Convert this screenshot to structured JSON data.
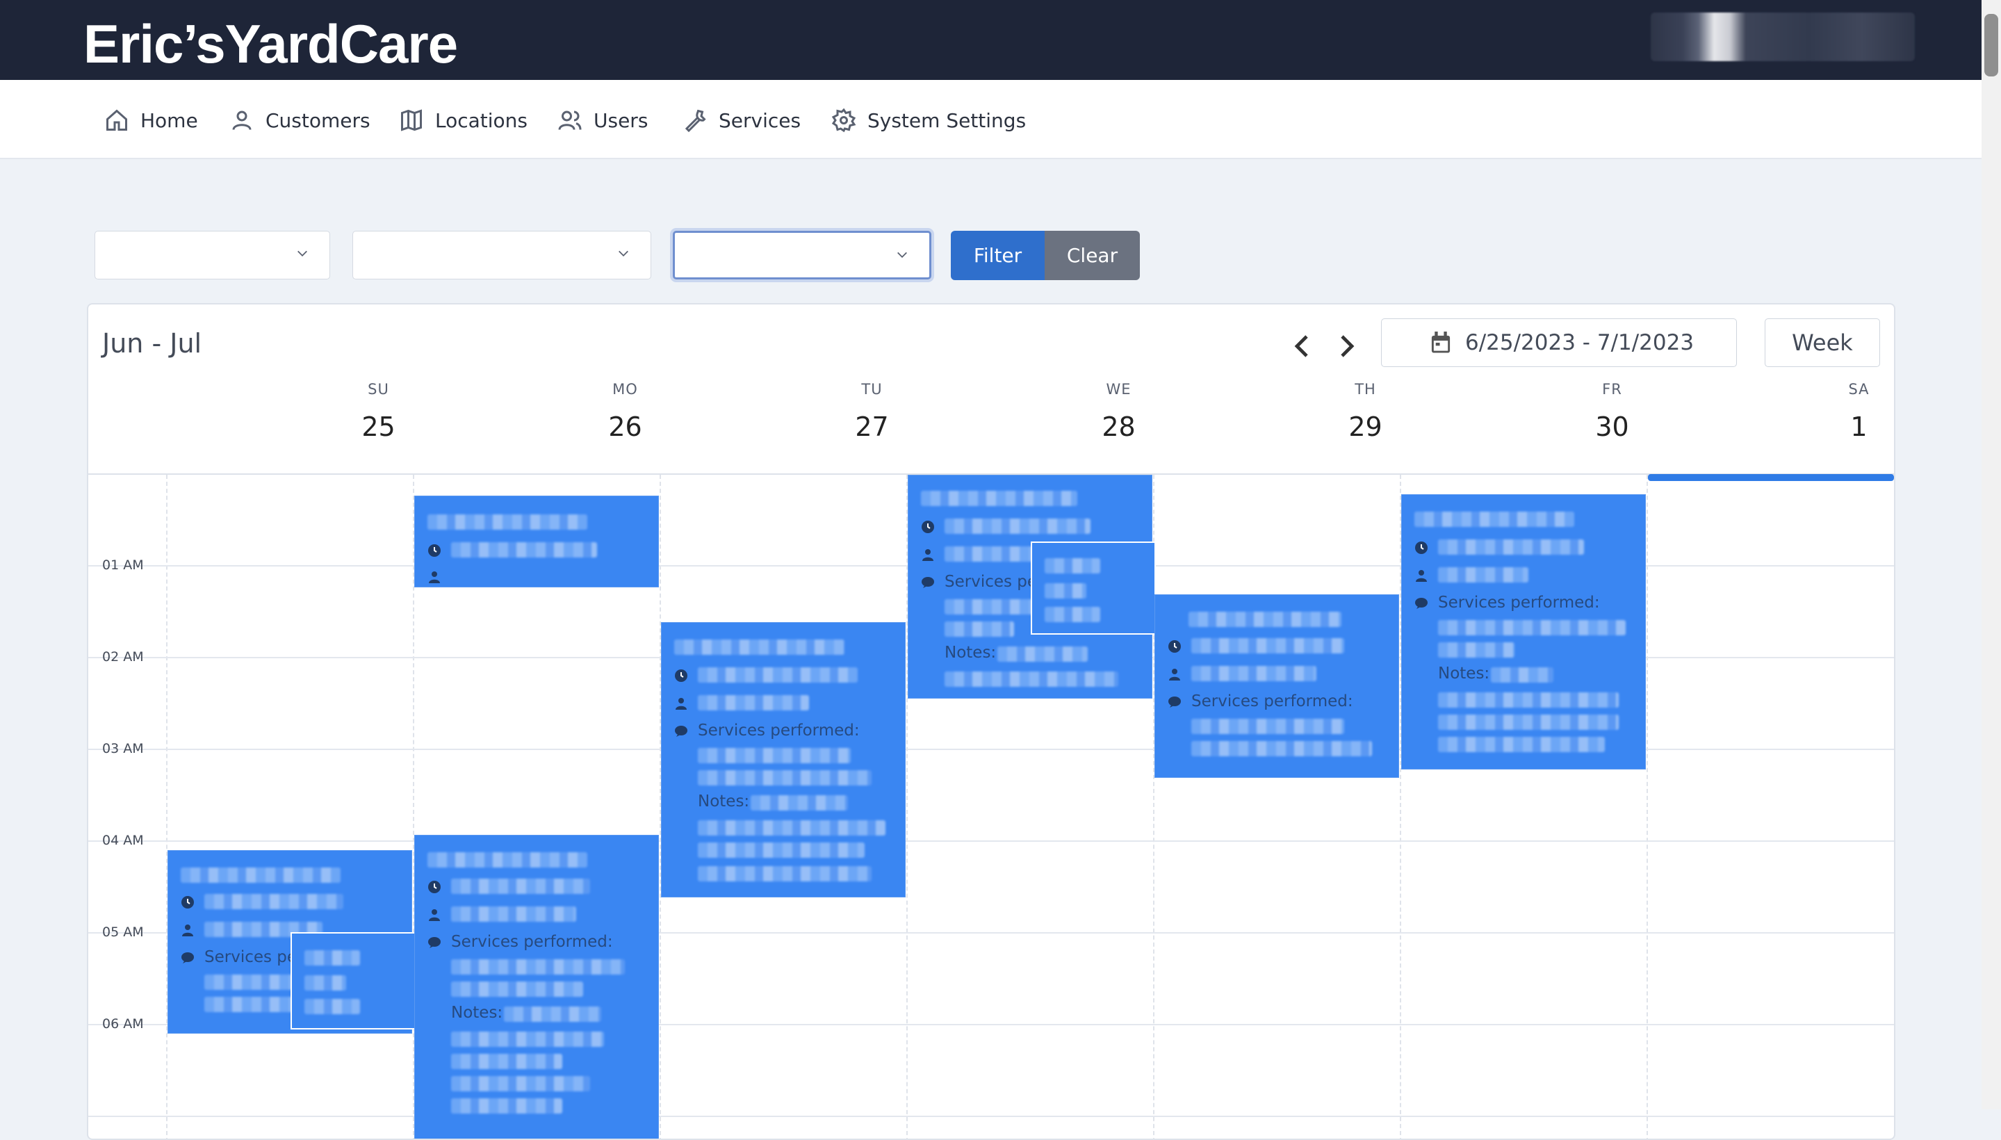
{
  "app": {
    "brand": "Eric’sYardCare"
  },
  "nav": {
    "items": [
      {
        "label": "Home",
        "icon": "home-icon"
      },
      {
        "label": "Customers",
        "icon": "user-icon"
      },
      {
        "label": "Locations",
        "icon": "map-icon"
      },
      {
        "label": "Users",
        "icon": "users-icon"
      },
      {
        "label": "Services",
        "icon": "wrench-icon"
      },
      {
        "label": "System Settings",
        "icon": "gear-icon"
      }
    ]
  },
  "filters": {
    "select1_value": "",
    "select2_value": "",
    "select3_value": "",
    "filter_label": "Filter",
    "clear_label": "Clear"
  },
  "calendar": {
    "title": "Jun - Jul",
    "date_range": "6/25/2023 - 7/1/2023",
    "view": "Week",
    "days": [
      {
        "name": "SU",
        "num": "25"
      },
      {
        "name": "MO",
        "num": "26"
      },
      {
        "name": "TU",
        "num": "27"
      },
      {
        "name": "WE",
        "num": "28"
      },
      {
        "name": "TH",
        "num": "29"
      },
      {
        "name": "FR",
        "num": "30"
      },
      {
        "name": "SA",
        "num": "1"
      }
    ],
    "hours": [
      "01 AM",
      "02 AM",
      "03 AM",
      "04 AM",
      "05 AM",
      "06 AM"
    ],
    "services_label": "Services performed:",
    "notes_label": "Notes:"
  },
  "colors": {
    "topbar": "#1e2538",
    "accent": "#2f6fcc",
    "event": "#3a86f2",
    "clear": "#6b7280"
  }
}
